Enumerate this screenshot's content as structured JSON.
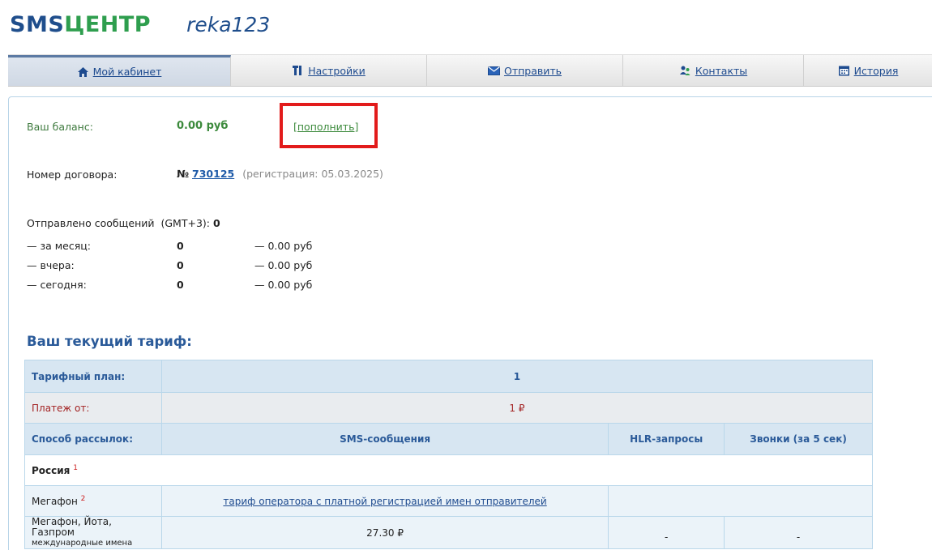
{
  "header": {
    "logo_sms": "SMS",
    "logo_center": "ЦЕНТР",
    "username": "reka123"
  },
  "nav": [
    {
      "label": "Мой кабинет",
      "icon": "home-icon"
    },
    {
      "label": "Настройки",
      "icon": "tools-icon"
    },
    {
      "label": "Отправить",
      "icon": "envelope-icon"
    },
    {
      "label": "Контакты",
      "icon": "people-icon"
    },
    {
      "label": "История",
      "icon": "calendar-icon"
    }
  ],
  "balance": {
    "label": "Ваш баланс:",
    "value": "0.00 руб",
    "topup": "[пополнить]"
  },
  "contract": {
    "label": "Номер договора:",
    "no_prefix": "№",
    "number": "730125",
    "registration": "(регистрация: 05.03.2025)"
  },
  "sent": {
    "label": "Отправлено сообщений",
    "tz": "(GMT+3):",
    "total": "0",
    "rows": [
      {
        "label": "— за месяц:",
        "count": "0",
        "amount": "— 0.00 руб"
      },
      {
        "label": "— вчера:",
        "count": "0",
        "amount": "— 0.00 руб"
      },
      {
        "label": "— сегодня:",
        "count": "0",
        "amount": "— 0.00 руб"
      }
    ]
  },
  "tariff": {
    "title": "Ваш текущий тариф:",
    "plan_label": "Тарифный план:",
    "plan_value": "1",
    "payment_label": "Платеж от:",
    "payment_value": "1 ₽",
    "method_label": "Способ рассылок:",
    "col_sms": "SMS-сообщения",
    "col_hlr": "HLR-запросы",
    "col_calls": "Звонки (за 5 сек)",
    "country": "Россия",
    "country_note": "1",
    "operator1": "Мегафон",
    "operator1_note": "2",
    "operator1_link": "тариф оператора с платной регистрацией имен отправителей",
    "operator2": "Мегафон, Йота, Газпром",
    "operator2_sub": "международные имена",
    "operator2_sms": "27.30 ₽",
    "operator2_hlr": "-",
    "operator2_calls": "-"
  },
  "colors": {
    "brand_blue": "#1f4e8c",
    "brand_green": "#2e9e4e",
    "highlight_red": "#e21b1b"
  }
}
